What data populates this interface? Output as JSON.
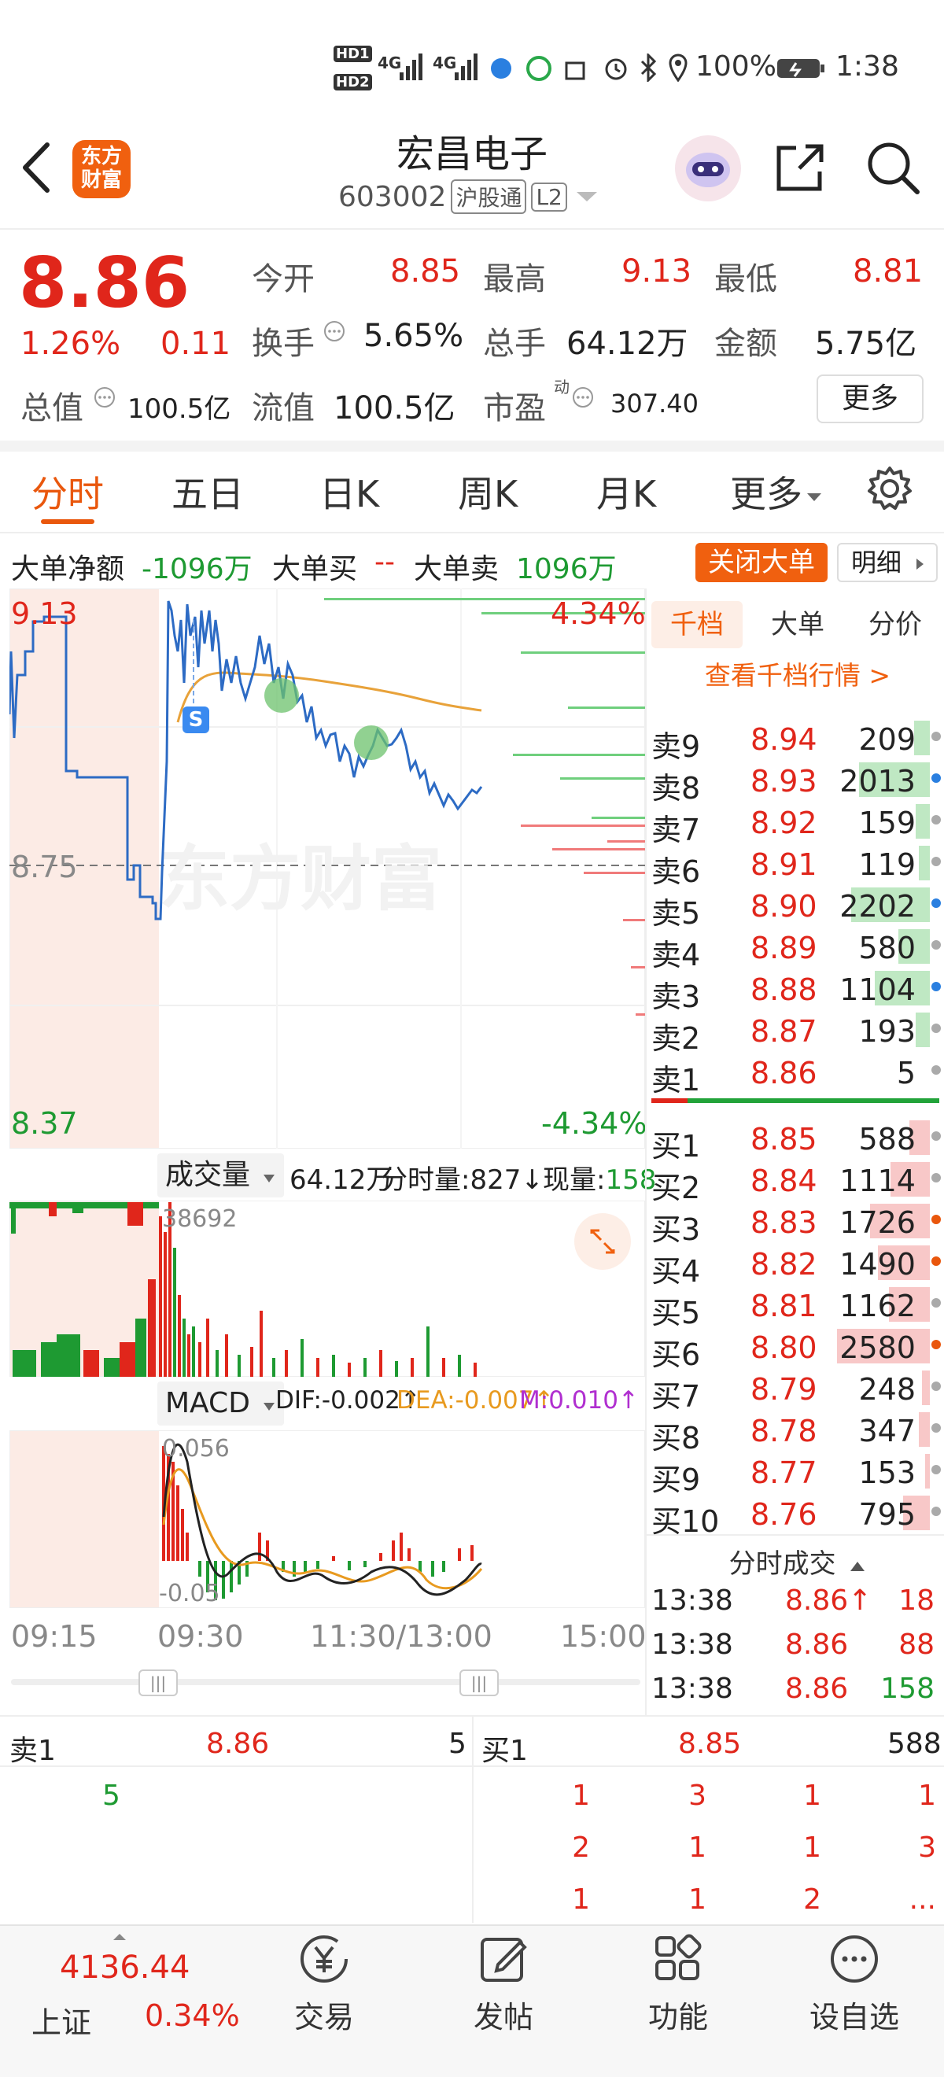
{
  "status_bar": {
    "battery": "100%",
    "time": "1:38",
    "net1": "4G",
    "net2": "4G",
    "hd1": "HD1",
    "hd2": "HD2"
  },
  "header": {
    "logo_line1": "东方",
    "logo_line2": "财富",
    "stock_name": "宏昌电子",
    "stock_code": "603002",
    "badge_hgt": "沪股通",
    "badge_l2": "L2"
  },
  "quote": {
    "price": "8.86",
    "change_pct": "1.26%",
    "change_val": "0.11",
    "open_label": "今开",
    "open_val": "8.85",
    "high_label": "最高",
    "high_val": "9.13",
    "low_label": "最低",
    "low_val": "8.81",
    "turnover_label": "换手",
    "turnover_val": "5.65%",
    "volume_label": "总手",
    "volume_val": "64.12万",
    "amount_label": "金额",
    "amount_val": "5.75亿",
    "mktcap_label": "总值",
    "mktcap_val": "100.5亿",
    "float_label": "流值",
    "float_val": "100.5亿",
    "pe_label": "市盈",
    "pe_sup": "动",
    "pe_val": "307.40",
    "more_btn": "更多"
  },
  "tabs": [
    "分时",
    "五日",
    "日K",
    "周K",
    "月K",
    "更多"
  ],
  "big_order": {
    "net_label": "大单净额",
    "net_val": "-1096万",
    "buy_label": "大单买",
    "buy_val": "--",
    "sell_label": "大单卖",
    "sell_val": "1096万",
    "close_btn": "关闭大单",
    "detail_btn": "明细"
  },
  "chart_labels": {
    "high_price": "9.13",
    "high_pct": "4.34%",
    "mid_price": "8.75",
    "low_price": "8.37",
    "low_pct": "-4.34%",
    "watermark": "东方财富",
    "s_marker": "S"
  },
  "volume_bar": {
    "selector": "成交量",
    "total": "64.12万",
    "fenshi_label": "分时量:",
    "fenshi_val": "827",
    "now_label": "现量:",
    "now_val": "158",
    "peak": "38692"
  },
  "macd_bar": {
    "selector": "MACD",
    "dif": "DIF:-0.002",
    "dea": "DEA:-0.007",
    "m": "M:0.010",
    "top": "0.056",
    "bottom": "-0.05"
  },
  "time_axis": [
    "09:15",
    "09:30",
    "11:30/13:00",
    "15:00"
  ],
  "depth_tabs": [
    "千档",
    "大单",
    "分价"
  ],
  "depth_link": "查看千档行情 >",
  "asks": [
    {
      "label": "卖9",
      "price": "8.94",
      "vol": "209"
    },
    {
      "label": "卖8",
      "price": "8.93",
      "vol": "2013"
    },
    {
      "label": "卖7",
      "price": "8.92",
      "vol": "159"
    },
    {
      "label": "卖6",
      "price": "8.91",
      "vol": "119"
    },
    {
      "label": "卖5",
      "price": "8.90",
      "vol": "2202"
    },
    {
      "label": "卖4",
      "price": "8.89",
      "vol": "580"
    },
    {
      "label": "卖3",
      "price": "8.88",
      "vol": "1104"
    },
    {
      "label": "卖2",
      "price": "8.87",
      "vol": "193"
    },
    {
      "label": "卖1",
      "price": "8.86",
      "vol": "5"
    }
  ],
  "bids": [
    {
      "label": "买1",
      "price": "8.85",
      "vol": "588"
    },
    {
      "label": "买2",
      "price": "8.84",
      "vol": "1114"
    },
    {
      "label": "买3",
      "price": "8.83",
      "vol": "1726"
    },
    {
      "label": "买4",
      "price": "8.82",
      "vol": "1490"
    },
    {
      "label": "买5",
      "price": "8.81",
      "vol": "1162"
    },
    {
      "label": "买6",
      "price": "8.80",
      "vol": "2580"
    },
    {
      "label": "买7",
      "price": "8.79",
      "vol": "248"
    },
    {
      "label": "买8",
      "price": "8.78",
      "vol": "347"
    },
    {
      "label": "买9",
      "price": "8.77",
      "vol": "153"
    },
    {
      "label": "买10",
      "price": "8.76",
      "vol": "795"
    }
  ],
  "trades_header": "分时成交",
  "trades": [
    {
      "time": "13:38",
      "price": "8.86↑",
      "vol": "18"
    },
    {
      "time": "13:38",
      "price": "8.86",
      "vol": "88"
    },
    {
      "time": "13:38",
      "price": "8.86",
      "vol": "158"
    }
  ],
  "queue": {
    "sell_label": "卖1",
    "sell_price": "8.86",
    "sell_vol": "5",
    "sell_items": [
      "5"
    ],
    "buy_label": "买1",
    "buy_price": "8.85",
    "buy_vol": "588",
    "buy_items": [
      "1",
      "3",
      "1",
      "1",
      "2",
      "1",
      "1",
      "3",
      "1",
      "1",
      "2",
      "..."
    ]
  },
  "bottom_nav": {
    "index_val": "4136.44",
    "index_name": "上证",
    "index_pct": "0.34%",
    "items": [
      "交易",
      "发帖",
      "功能",
      "设自选"
    ]
  }
}
